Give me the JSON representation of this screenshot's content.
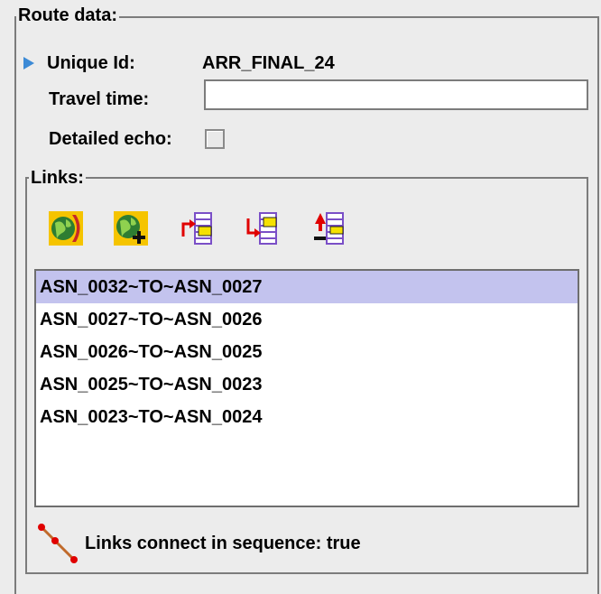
{
  "route_section": {
    "title": "Route data:"
  },
  "unique_id": {
    "label": "Unique Id:",
    "value": "ARR_FINAL_24"
  },
  "travel_time": {
    "label": "Travel time:",
    "value": ""
  },
  "detailed_echo": {
    "label": "Detailed echo:",
    "checked": false
  },
  "links": {
    "title": "Links:",
    "toolbar": [
      {
        "icon": "globe-remove-icon"
      },
      {
        "icon": "globe-add-icon"
      },
      {
        "icon": "insert-before-icon"
      },
      {
        "icon": "insert-after-icon"
      },
      {
        "icon": "sort-order-icon"
      }
    ],
    "items": [
      {
        "label": "ASN_0032~TO~ASN_0027",
        "selected": true
      },
      {
        "label": "ASN_0027~TO~ASN_0026",
        "selected": false
      },
      {
        "label": "ASN_0026~TO~ASN_0025",
        "selected": false
      },
      {
        "label": "ASN_0025~TO~ASN_0023",
        "selected": false
      },
      {
        "label": "ASN_0023~TO~ASN_0024",
        "selected": false
      }
    ]
  },
  "status": {
    "icon": "sequence-line-icon",
    "text": "Links connect in sequence: true"
  },
  "colors": {
    "selection": "#c3c3ee",
    "pointer": "#3c8ad6",
    "panel": "#ececec",
    "border": "#7c7c7c"
  }
}
